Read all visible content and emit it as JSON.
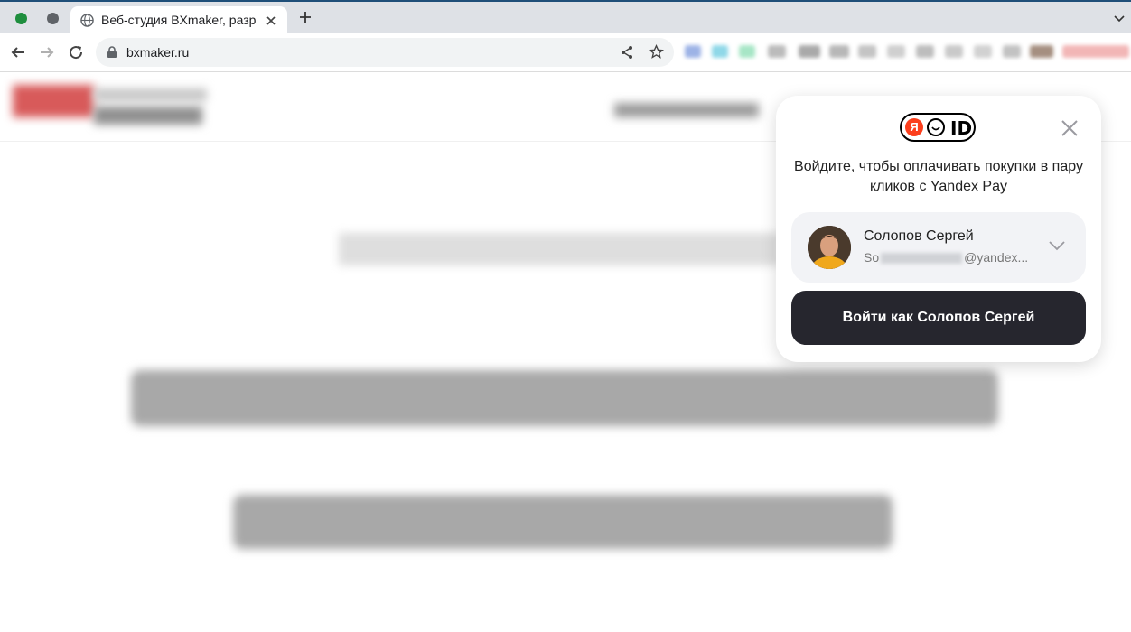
{
  "browser": {
    "tab_title": "Веб-студия BXmaker, разр",
    "url": "bxmaker.ru",
    "colors": {
      "topline": "#1f4f79",
      "tabstrip": "#dee1e6",
      "traffic_green": "#1e8e3e",
      "traffic_gray": "#5f6368"
    },
    "icons": [
      "globe-icon",
      "close-icon",
      "plus-icon",
      "chevron-down-icon",
      "back-icon",
      "forward-icon",
      "reload-icon",
      "lock-icon",
      "share-icon",
      "star-icon"
    ]
  },
  "yandex_id": {
    "logo": {
      "ya": "Я",
      "id": "ID"
    },
    "message": "Войдите, чтобы оплачивать покупки в пару кликов с Yandex Pay",
    "account": {
      "name": "Солопов Сергей",
      "email_prefix": "So",
      "email_suffix": "@yandex..."
    },
    "login_button": "Войти как Солопов Сергей",
    "colors": {
      "brand_red": "#fc3f1d",
      "button_bg": "#26262e",
      "card_bg": "#f2f3f6"
    }
  }
}
